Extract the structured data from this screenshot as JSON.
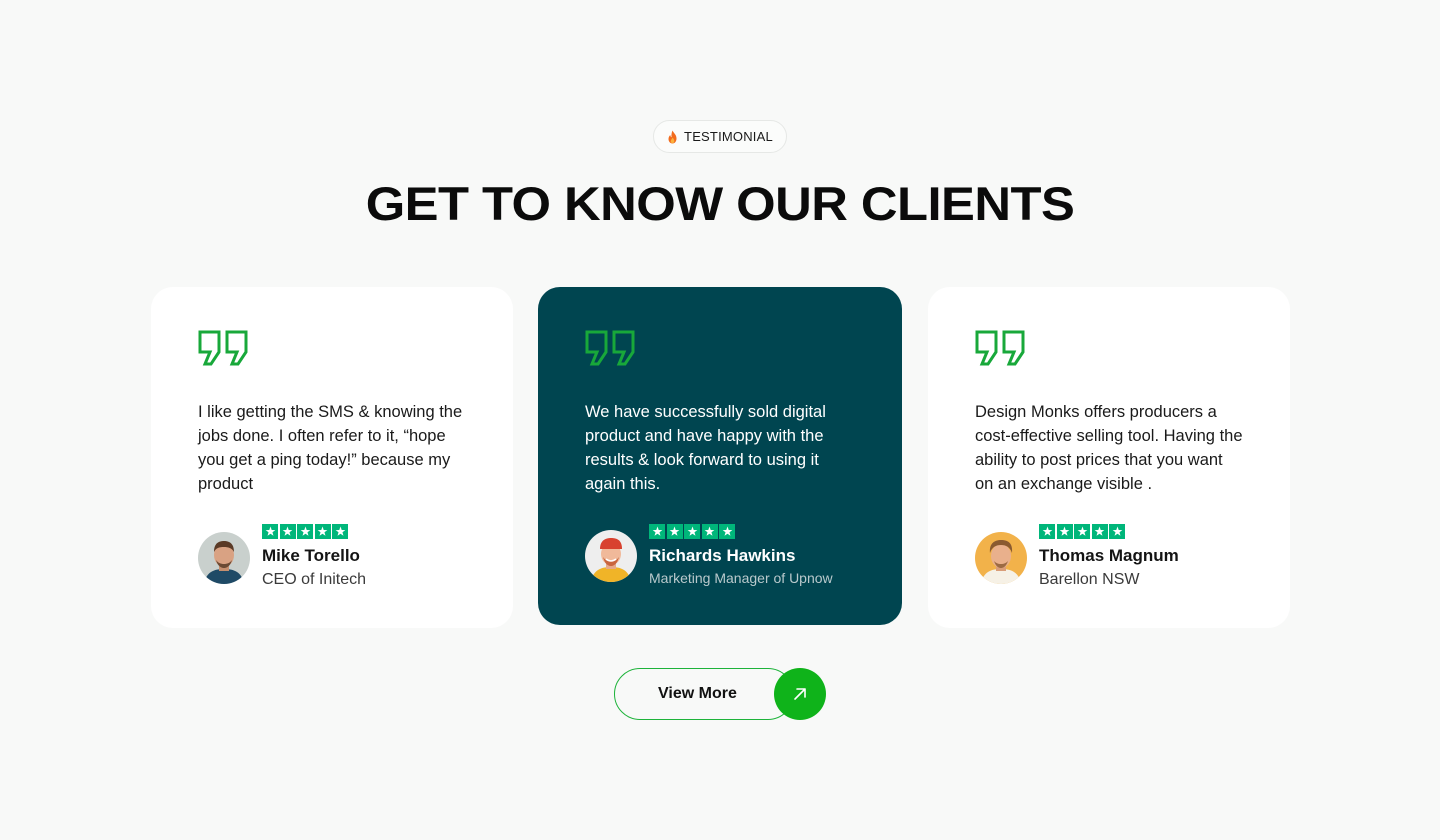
{
  "section": {
    "badge": "TESTIMONIAL",
    "title": "GET TO KNOW OUR CLIENTS"
  },
  "colors": {
    "accent_green": "#0fb31a",
    "trustpilot_green": "#00b67a",
    "featured_card_bg": "#004550",
    "page_bg": "#f8f9f8"
  },
  "testimonials": [
    {
      "text": "I like getting the SMS & knowing the jobs done. I often refer to it, “hope you get a ping today!” because my product",
      "rating": 5,
      "name": "Mike Torello",
      "role": "CEO of Initech",
      "featured": false
    },
    {
      "text": "We have successfully sold digital product and have happy with the results & look forward to using it again this.",
      "rating": 5,
      "name": "Richards Hawkins",
      "role": "Marketing Manager of Upnow",
      "featured": true
    },
    {
      "text": "Design Monks offers producers a cost-effective selling tool. Having the ability to post prices that you want on an exchange visible .",
      "rating": 5,
      "name": "Thomas Magnum",
      "role": "Barellon NSW",
      "featured": false
    }
  ],
  "cta": {
    "label": "View More",
    "icon": "arrow-up-right-icon"
  }
}
